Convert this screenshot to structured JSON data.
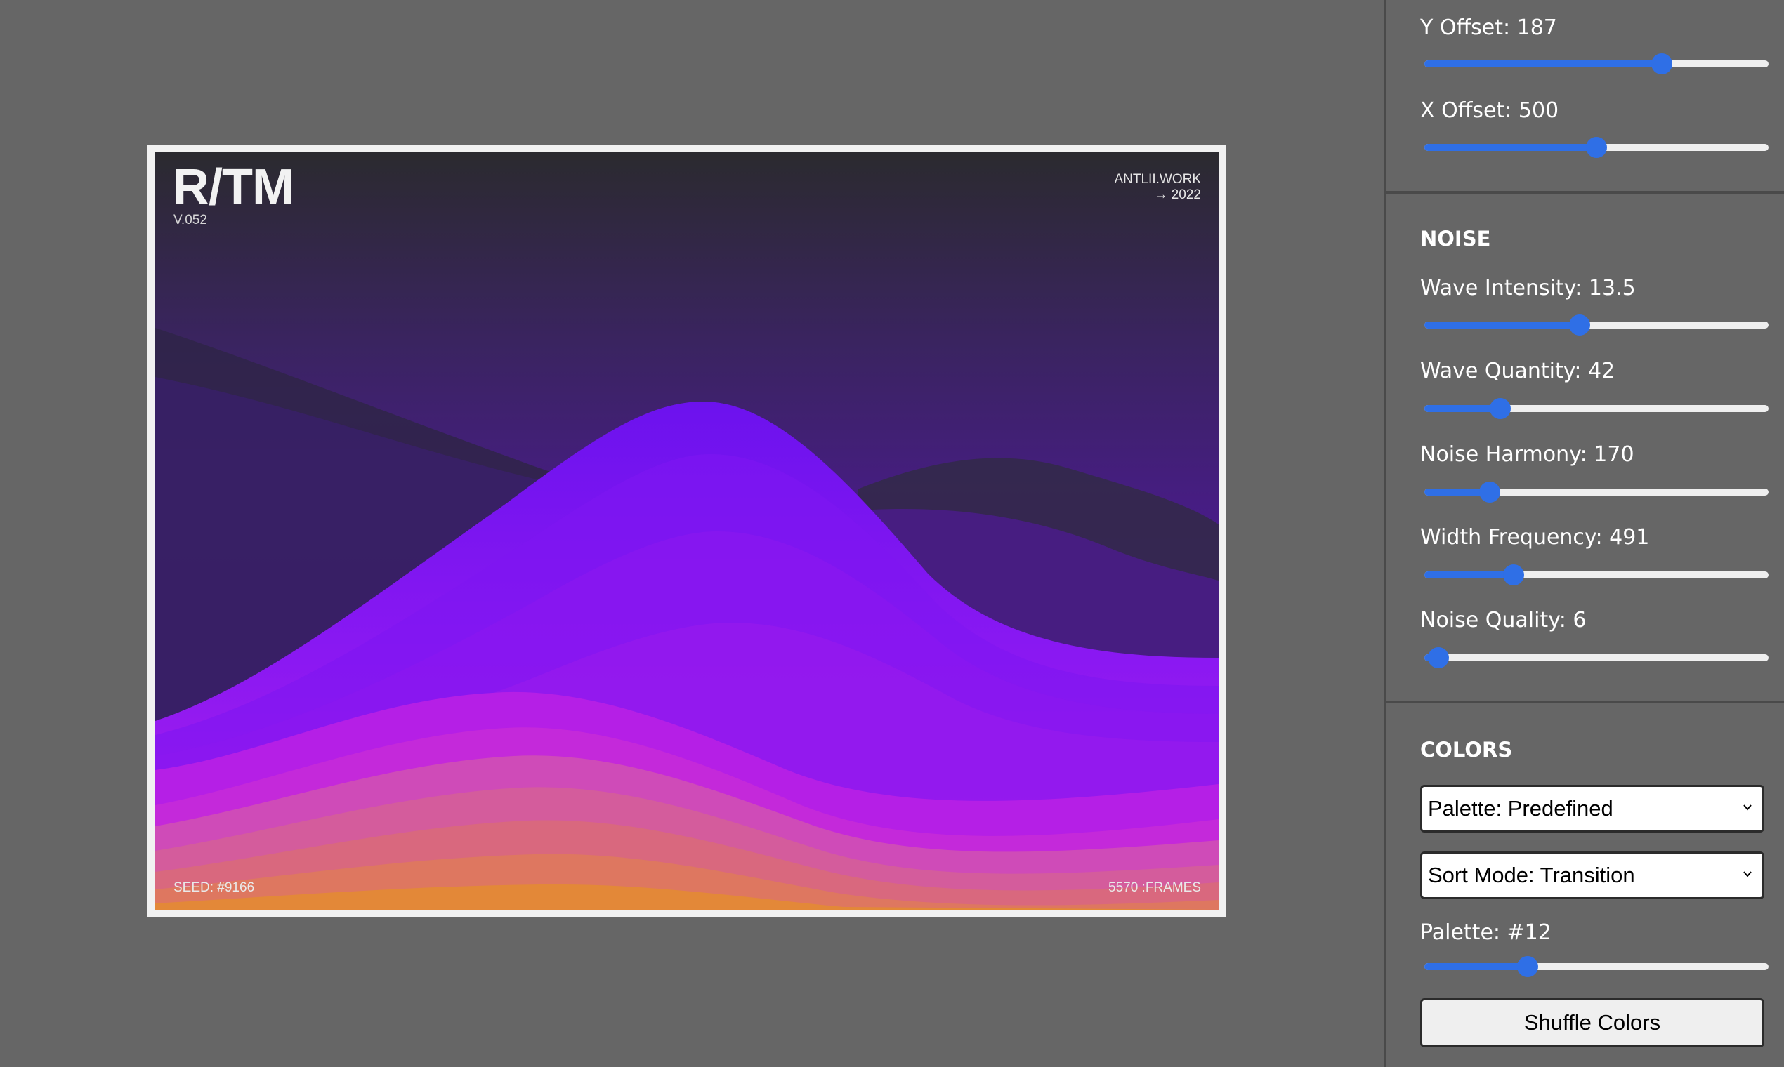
{
  "artwork": {
    "title": "R/TM",
    "version": "V.052",
    "credit_line1": "ANTLII.WORK",
    "credit_line2": "→ 2022",
    "seed": "SEED: #9166",
    "frames": "5570 :FRAMES"
  },
  "panel": {
    "position": {
      "y_offset": {
        "label": "Y Offset: 187",
        "fraction": 0.69
      },
      "x_offset": {
        "label": "X Offset: 500",
        "fraction": 0.5
      }
    },
    "noise": {
      "title": "NOISE",
      "wave_intensity": {
        "label": "Wave Intensity: 13.5",
        "fraction": 0.45
      },
      "wave_quantity": {
        "label": "Wave Quantity: 42",
        "fraction": 0.22
      },
      "noise_harmony": {
        "label": "Noise Harmony: 170",
        "fraction": 0.19
      },
      "width_frequency": {
        "label": "Width Frequency: 491",
        "fraction": 0.26
      },
      "noise_quality": {
        "label": "Noise Quality: 6",
        "fraction": 0.04
      }
    },
    "colors": {
      "title": "COLORS",
      "palette_select": "Palette: Predefined",
      "sort_mode_select": "Sort Mode: Transition",
      "palette_slider": {
        "label": "Palette: #12",
        "fraction": 0.3
      },
      "shuffle_button": "Shuffle Colors"
    }
  },
  "colors": {
    "accent": "#2f6fe6",
    "background": "#666666",
    "wave_top": "#2b2a30",
    "wave_violet": "#7a18f0",
    "wave_magenta": "#c724e0",
    "wave_orange": "#e38838"
  }
}
